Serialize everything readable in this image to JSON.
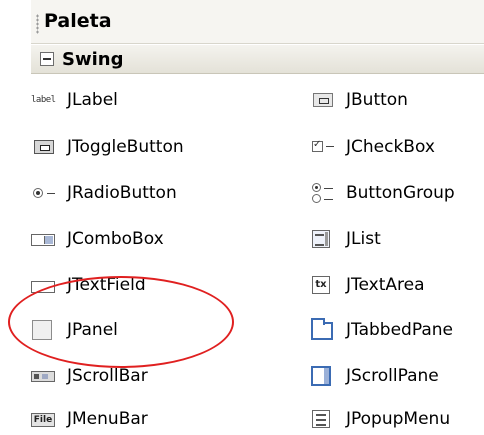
{
  "palette": {
    "title": "Paleta",
    "category": {
      "label": "Swing",
      "expanded": true
    },
    "items": [
      {
        "label": "JLabel",
        "icon": "jlabel-icon"
      },
      {
        "label": "JButton",
        "icon": "jbutton-icon"
      },
      {
        "label": "JToggleButton",
        "icon": "jtogglebutton-icon"
      },
      {
        "label": "JCheckBox",
        "icon": "jcheckbox-icon"
      },
      {
        "label": "JRadioButton",
        "icon": "jradiobutton-icon"
      },
      {
        "label": "ButtonGroup",
        "icon": "buttongroup-icon"
      },
      {
        "label": "JComboBox",
        "icon": "jcombobox-icon"
      },
      {
        "label": "JList",
        "icon": "jlist-icon"
      },
      {
        "label": "JTextField",
        "icon": "jtextfield-icon"
      },
      {
        "label": "JTextArea",
        "icon": "jtextarea-icon"
      },
      {
        "label": "JPanel",
        "icon": "jpanel-icon"
      },
      {
        "label": "JTabbedPane",
        "icon": "jtabbedpane-icon"
      },
      {
        "label": "JScrollBar",
        "icon": "jscrollbar-icon"
      },
      {
        "label": "JScrollPane",
        "icon": "jscrollpane-icon"
      },
      {
        "label": "JMenuBar",
        "icon": "jmenubar-icon"
      },
      {
        "label": "JPopupMenu",
        "icon": "jpopupmenu-icon"
      }
    ],
    "icon_text": {
      "jlabel": "label",
      "jtextarea": "tx",
      "jmenubar": "File"
    },
    "highlight_color": "#e02020"
  }
}
